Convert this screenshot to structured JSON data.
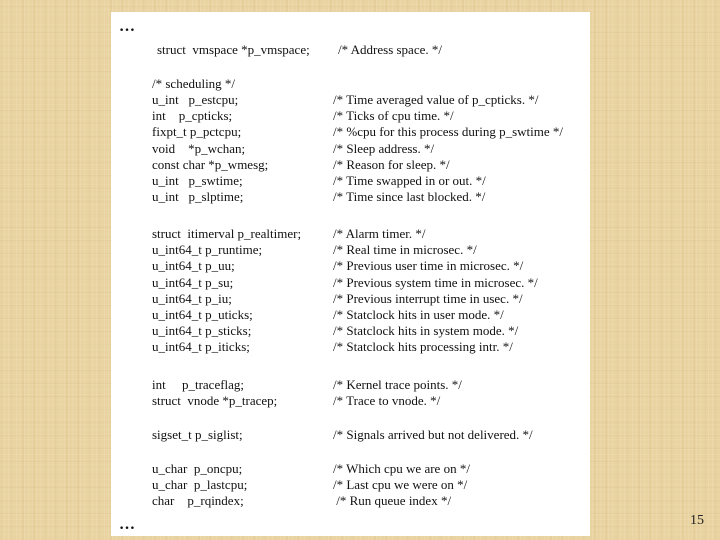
{
  "slide": {
    "ellipsis_top": "…",
    "ellipsis_bottom": "…",
    "page_number": "15"
  },
  "code": {
    "vmspace": {
      "decl": "struct  vmspace *p_vmspace;",
      "comment": "/* Address space. */"
    },
    "scheduling_header": "/* scheduling */",
    "scheduling": [
      {
        "decl": "u_int   p_estcpu;",
        "comment": "/* Time averaged value of p_cpticks. */"
      },
      {
        "decl": "int    p_cpticks;",
        "comment": "/* Ticks of cpu time. */"
      },
      {
        "decl": "fixpt_t p_pctcpu;",
        "comment": "/* %cpu for this process during p_swtime */"
      },
      {
        "decl": "void    *p_wchan;",
        "comment": "/* Sleep address. */"
      },
      {
        "decl": "const char *p_wmesg;",
        "comment": "/* Reason for sleep. */"
      },
      {
        "decl": "u_int   p_swtime;",
        "comment": "/* Time swapped in or out. */"
      },
      {
        "decl": "u_int   p_slptime;",
        "comment": "/* Time since last blocked. */"
      }
    ],
    "timing": [
      {
        "decl": "struct  itimerval p_realtimer;",
        "comment": "/* Alarm timer. */"
      },
      {
        "decl": "u_int64_t p_runtime;",
        "comment": "/* Real time in microsec. */"
      },
      {
        "decl": "u_int64_t p_uu;",
        "comment": "/* Previous user time in microsec. */"
      },
      {
        "decl": "u_int64_t p_su;",
        "comment": "/* Previous system time in microsec. */"
      },
      {
        "decl": "u_int64_t p_iu;",
        "comment": "/* Previous interrupt time in usec. */"
      },
      {
        "decl": "u_int64_t p_uticks;",
        "comment": "/* Statclock hits in user mode. */"
      },
      {
        "decl": "u_int64_t p_sticks;",
        "comment": "/* Statclock hits in system mode. */"
      },
      {
        "decl": "u_int64_t p_iticks;",
        "comment": "/* Statclock hits processing intr. */"
      }
    ],
    "trace": [
      {
        "decl": "int     p_traceflag;",
        "comment": "/* Kernel trace points. */"
      },
      {
        "decl": "struct  vnode *p_tracep;",
        "comment": "/* Trace to vnode. */"
      }
    ],
    "signals": [
      {
        "decl": "sigset_t p_siglist;",
        "comment": "/* Signals arrived but not delivered. */"
      }
    ],
    "cpu": [
      {
        "decl": "u_char  p_oncpu;",
        "comment": "/* Which cpu we are on */"
      },
      {
        "decl": "u_char  p_lastcpu;",
        "comment": "/* Last cpu we were on */"
      },
      {
        "decl": "char    p_rqindex;",
        "comment": " /* Run queue index */"
      }
    ]
  }
}
